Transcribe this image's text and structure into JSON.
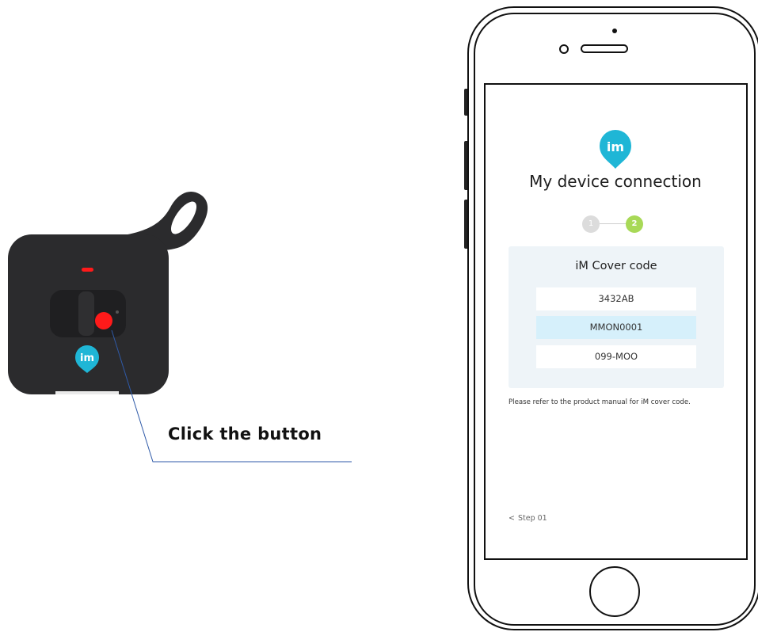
{
  "callout": {
    "label": "Click the button"
  },
  "app": {
    "logo_text": "im",
    "title": "My device connection",
    "steps": [
      {
        "number": "1",
        "state": "done"
      },
      {
        "number": "2",
        "state": "current"
      }
    ],
    "code_panel": {
      "title": "iM Cover code",
      "codes": [
        "3432AB",
        "MMON0001",
        "099-MOO"
      ],
      "selected_index": 1
    },
    "hint": "Please refer to the product manual for iM cover code.",
    "back_link": {
      "chevron": "<",
      "label": "Step 01"
    }
  },
  "colors": {
    "device_body": "#2b2b2d",
    "device_accent_button": "#ff1a1a",
    "brand_teal": "#1fb6d6",
    "step_active": "#a8d957",
    "step_inactive": "#dcdcdc",
    "panel_bg": "#eef4f8",
    "selected_row": "#d6f0fb",
    "callout_line": "#2f5aa8"
  },
  "icons": {
    "device_logo": "im-pin-logo-icon",
    "app_logo": "im-pin-logo-icon",
    "back": "chevron-left-icon"
  }
}
